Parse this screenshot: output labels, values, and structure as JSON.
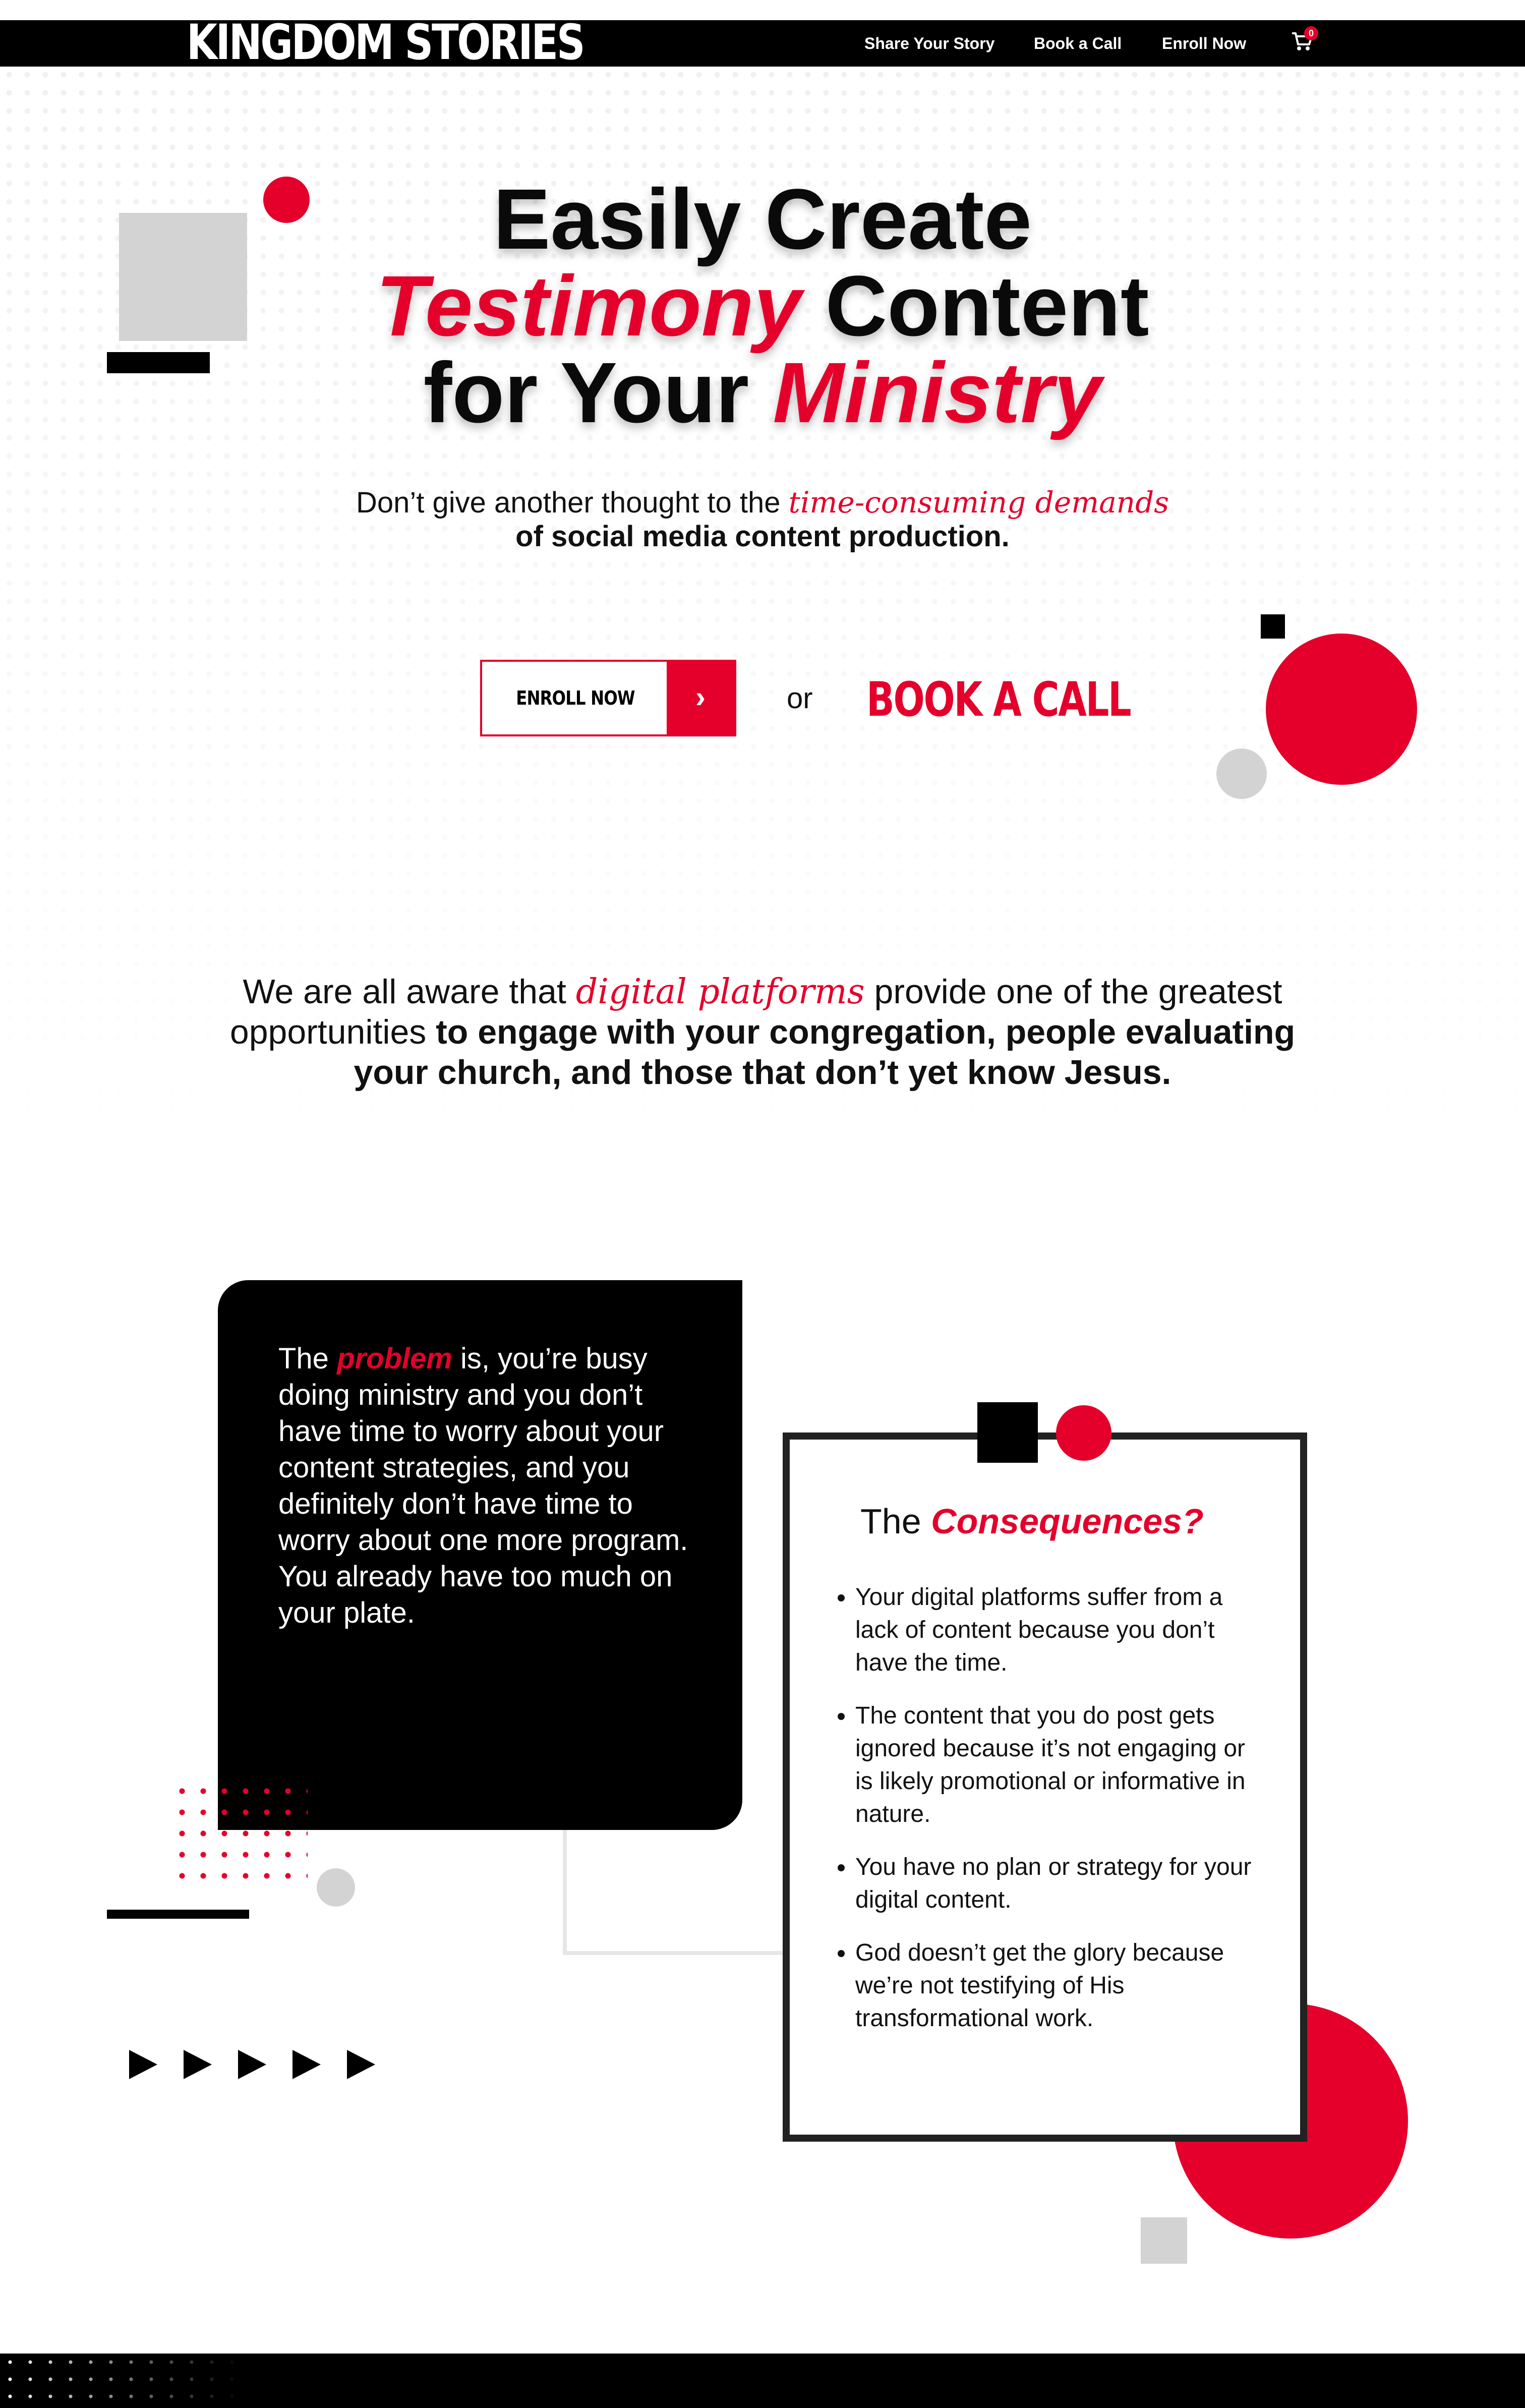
{
  "nav": {
    "logo": "KINGDOM STORIES",
    "links": [
      "Share Your Story",
      "Book a Call",
      "Enroll Now"
    ],
    "cart_count": "0"
  },
  "hero": {
    "line1": "Easily Create",
    "line2_red": "Testimony",
    "line2_rest": " Content",
    "line3_start": "for Your ",
    "line3_red": "Ministry",
    "sub_a": "Don’t give another thought to the ",
    "sub_red": "time-consuming demands",
    "sub_b": "of social media content production.",
    "enroll_label": "ENROLL NOW",
    "or": "or",
    "book_call": "BOOK A CALL"
  },
  "aware": {
    "a": "We are all aware that ",
    "red": "digital platforms",
    "b": " provide one of the greatest",
    "c": "opportunities ",
    "bold1": "to engage with your congregation, people evaluating",
    "bold2": "your church, and those that don’t yet know Jesus."
  },
  "problem": {
    "a": "The ",
    "red": "problem",
    "b": " is, you’re busy doing ministry and you don’t have time to worry about your content strategies, and you definitely don’t have time to worry about one more program. You already have too much on your plate."
  },
  "consequences": {
    "title_a": "The ",
    "title_red": "Consequences?",
    "items": [
      "Your digital platforms suffer from a lack of content because you don’t have the time.",
      "The content that you do post gets ignored because it’s not engaging or is likely promotional or informative in nature.",
      "You have no plan or strategy for your digital content.",
      "God doesn’t get the glory because we’re not testifying of His transformational work."
    ]
  },
  "colors": {
    "accent": "#e4002b",
    "dark": "#000000",
    "light_gray": "#d3d3d3"
  }
}
